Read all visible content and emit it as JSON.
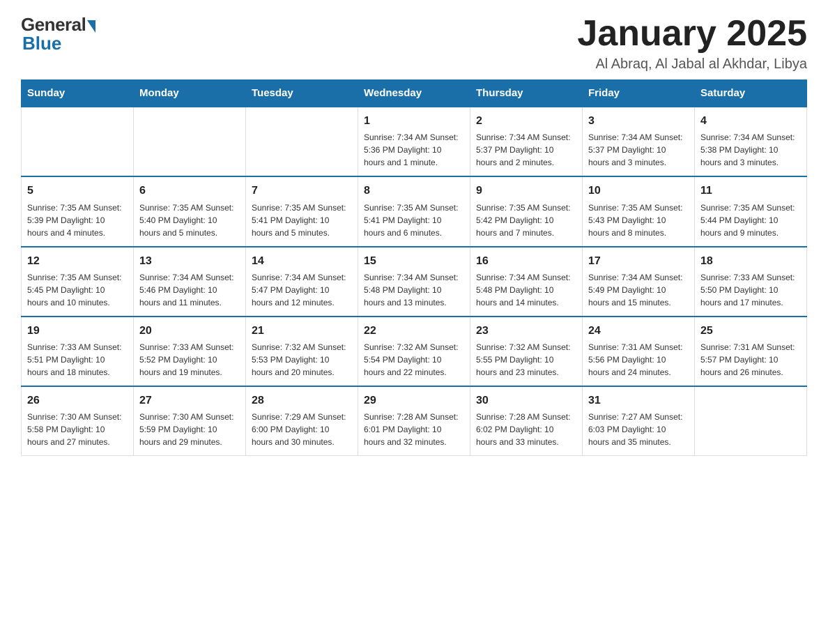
{
  "logo": {
    "general": "General",
    "blue": "Blue"
  },
  "title": "January 2025",
  "location": "Al Abraq, Al Jabal al Akhdar, Libya",
  "days_of_week": [
    "Sunday",
    "Monday",
    "Tuesday",
    "Wednesday",
    "Thursday",
    "Friday",
    "Saturday"
  ],
  "weeks": [
    [
      {
        "day": "",
        "info": ""
      },
      {
        "day": "",
        "info": ""
      },
      {
        "day": "",
        "info": ""
      },
      {
        "day": "1",
        "info": "Sunrise: 7:34 AM\nSunset: 5:36 PM\nDaylight: 10 hours and 1 minute."
      },
      {
        "day": "2",
        "info": "Sunrise: 7:34 AM\nSunset: 5:37 PM\nDaylight: 10 hours and 2 minutes."
      },
      {
        "day": "3",
        "info": "Sunrise: 7:34 AM\nSunset: 5:37 PM\nDaylight: 10 hours and 3 minutes."
      },
      {
        "day": "4",
        "info": "Sunrise: 7:34 AM\nSunset: 5:38 PM\nDaylight: 10 hours and 3 minutes."
      }
    ],
    [
      {
        "day": "5",
        "info": "Sunrise: 7:35 AM\nSunset: 5:39 PM\nDaylight: 10 hours and 4 minutes."
      },
      {
        "day": "6",
        "info": "Sunrise: 7:35 AM\nSunset: 5:40 PM\nDaylight: 10 hours and 5 minutes."
      },
      {
        "day": "7",
        "info": "Sunrise: 7:35 AM\nSunset: 5:41 PM\nDaylight: 10 hours and 5 minutes."
      },
      {
        "day": "8",
        "info": "Sunrise: 7:35 AM\nSunset: 5:41 PM\nDaylight: 10 hours and 6 minutes."
      },
      {
        "day": "9",
        "info": "Sunrise: 7:35 AM\nSunset: 5:42 PM\nDaylight: 10 hours and 7 minutes."
      },
      {
        "day": "10",
        "info": "Sunrise: 7:35 AM\nSunset: 5:43 PM\nDaylight: 10 hours and 8 minutes."
      },
      {
        "day": "11",
        "info": "Sunrise: 7:35 AM\nSunset: 5:44 PM\nDaylight: 10 hours and 9 minutes."
      }
    ],
    [
      {
        "day": "12",
        "info": "Sunrise: 7:35 AM\nSunset: 5:45 PM\nDaylight: 10 hours and 10 minutes."
      },
      {
        "day": "13",
        "info": "Sunrise: 7:34 AM\nSunset: 5:46 PM\nDaylight: 10 hours and 11 minutes."
      },
      {
        "day": "14",
        "info": "Sunrise: 7:34 AM\nSunset: 5:47 PM\nDaylight: 10 hours and 12 minutes."
      },
      {
        "day": "15",
        "info": "Sunrise: 7:34 AM\nSunset: 5:48 PM\nDaylight: 10 hours and 13 minutes."
      },
      {
        "day": "16",
        "info": "Sunrise: 7:34 AM\nSunset: 5:48 PM\nDaylight: 10 hours and 14 minutes."
      },
      {
        "day": "17",
        "info": "Sunrise: 7:34 AM\nSunset: 5:49 PM\nDaylight: 10 hours and 15 minutes."
      },
      {
        "day": "18",
        "info": "Sunrise: 7:33 AM\nSunset: 5:50 PM\nDaylight: 10 hours and 17 minutes."
      }
    ],
    [
      {
        "day": "19",
        "info": "Sunrise: 7:33 AM\nSunset: 5:51 PM\nDaylight: 10 hours and 18 minutes."
      },
      {
        "day": "20",
        "info": "Sunrise: 7:33 AM\nSunset: 5:52 PM\nDaylight: 10 hours and 19 minutes."
      },
      {
        "day": "21",
        "info": "Sunrise: 7:32 AM\nSunset: 5:53 PM\nDaylight: 10 hours and 20 minutes."
      },
      {
        "day": "22",
        "info": "Sunrise: 7:32 AM\nSunset: 5:54 PM\nDaylight: 10 hours and 22 minutes."
      },
      {
        "day": "23",
        "info": "Sunrise: 7:32 AM\nSunset: 5:55 PM\nDaylight: 10 hours and 23 minutes."
      },
      {
        "day": "24",
        "info": "Sunrise: 7:31 AM\nSunset: 5:56 PM\nDaylight: 10 hours and 24 minutes."
      },
      {
        "day": "25",
        "info": "Sunrise: 7:31 AM\nSunset: 5:57 PM\nDaylight: 10 hours and 26 minutes."
      }
    ],
    [
      {
        "day": "26",
        "info": "Sunrise: 7:30 AM\nSunset: 5:58 PM\nDaylight: 10 hours and 27 minutes."
      },
      {
        "day": "27",
        "info": "Sunrise: 7:30 AM\nSunset: 5:59 PM\nDaylight: 10 hours and 29 minutes."
      },
      {
        "day": "28",
        "info": "Sunrise: 7:29 AM\nSunset: 6:00 PM\nDaylight: 10 hours and 30 minutes."
      },
      {
        "day": "29",
        "info": "Sunrise: 7:28 AM\nSunset: 6:01 PM\nDaylight: 10 hours and 32 minutes."
      },
      {
        "day": "30",
        "info": "Sunrise: 7:28 AM\nSunset: 6:02 PM\nDaylight: 10 hours and 33 minutes."
      },
      {
        "day": "31",
        "info": "Sunrise: 7:27 AM\nSunset: 6:03 PM\nDaylight: 10 hours and 35 minutes."
      },
      {
        "day": "",
        "info": ""
      }
    ]
  ]
}
